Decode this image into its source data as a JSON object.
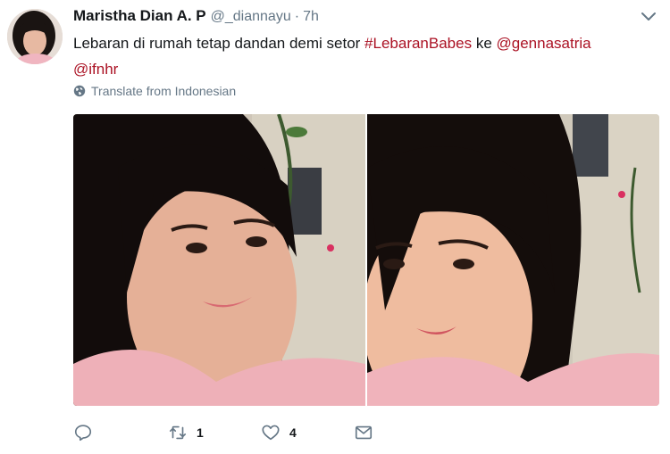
{
  "tweet": {
    "author_name": "Maristha Dian A. P",
    "author_handle": "@_diannayu",
    "separator": "·",
    "time": "7h",
    "text_plain": "Lebaran di rumah tetap dandan demi setor ",
    "hashtag": "#LebaranBabes",
    "text_ke": " ke ",
    "mention_1": "@gennasatria",
    "mention_2": "@ifnhr",
    "translate_label": "Translate from Indonesian",
    "reply_count": "",
    "retweet_count": "1",
    "like_count": "4"
  },
  "icons": {
    "avatar": "avatar",
    "caret": "chevron-down-icon",
    "globe": "globe-icon",
    "reply": "reply-icon",
    "retweet": "retweet-icon",
    "like": "heart-icon",
    "dm": "envelope-icon"
  },
  "colors": {
    "hashtag": "#ab1224",
    "mention": "#ab1224",
    "meta": "#657786",
    "text": "#14171a"
  }
}
